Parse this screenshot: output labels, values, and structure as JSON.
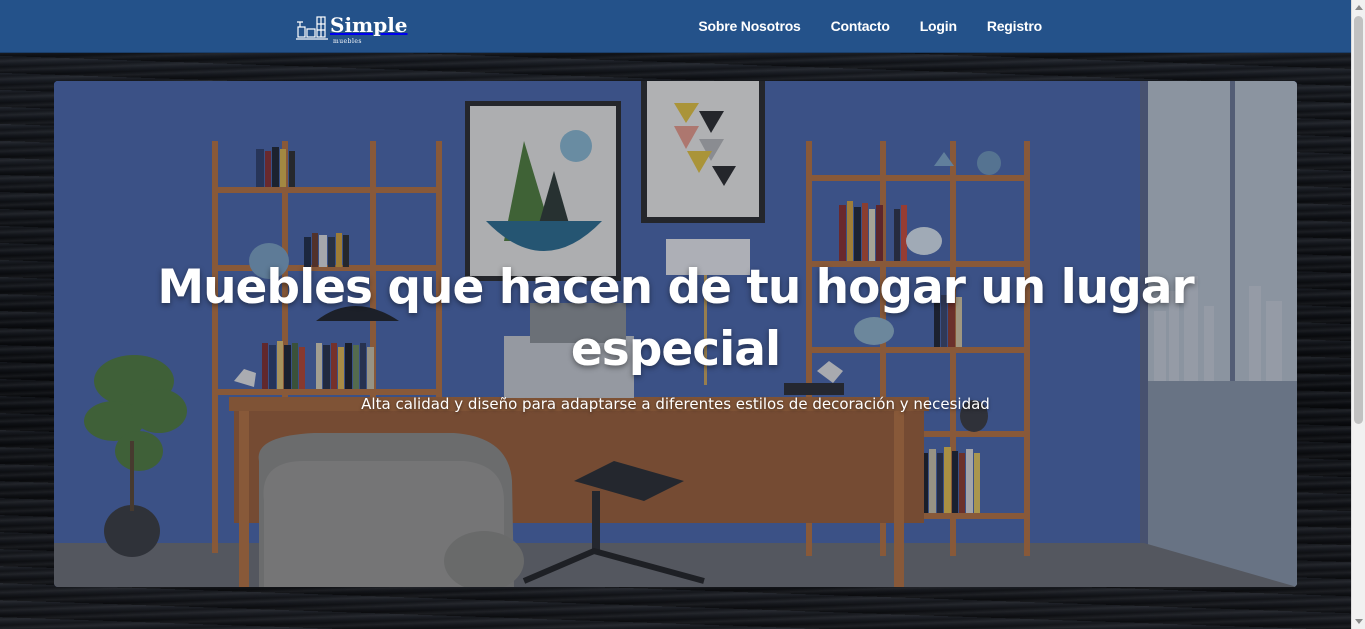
{
  "brand": {
    "name": "Simple",
    "tagline": "muebles",
    "icon": "furniture-logo-icon"
  },
  "nav": {
    "items": [
      {
        "label": "Sobre Nosotros"
      },
      {
        "label": "Contacto"
      },
      {
        "label": "Login"
      },
      {
        "label": "Registro"
      }
    ]
  },
  "hero": {
    "title_line1": "Muebles que hacen de tu hogar un lugar",
    "title_line2": "especial",
    "subtitle": "Alta calidad y diseño para adaptarse a diferentes estilos de decoración y necesidad",
    "image": "home-office-interior-image"
  },
  "colors": {
    "navbar": "#24528a",
    "wall": "#3c5795",
    "wood": "#b5713d"
  }
}
